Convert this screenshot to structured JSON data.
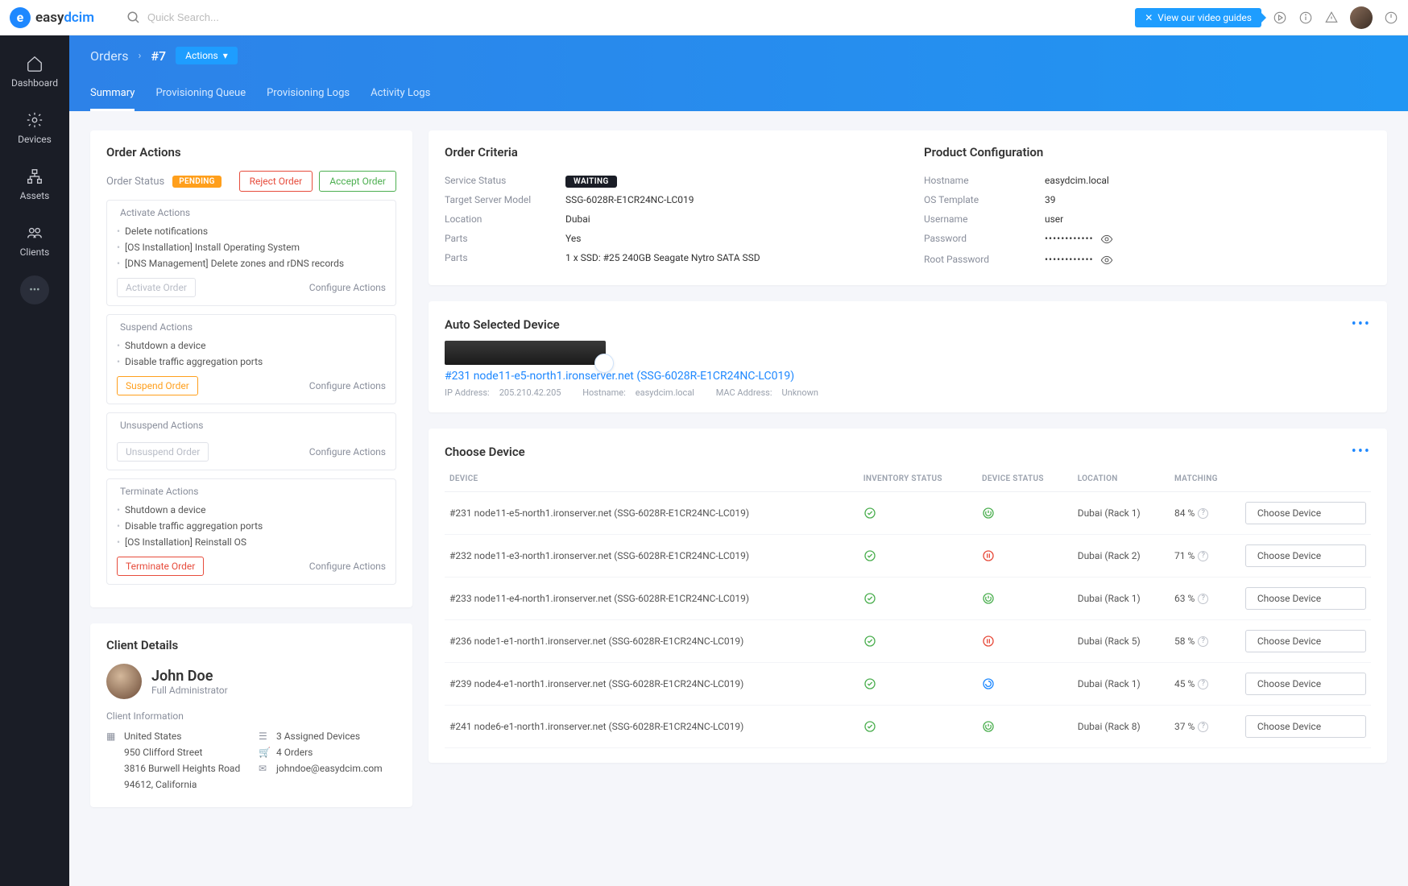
{
  "logo": {
    "text_dark": "easy",
    "text_accent": "dcim"
  },
  "search": {
    "placeholder": "Quick Search..."
  },
  "topbar": {
    "video_guides_label": "View our video guides"
  },
  "sidebar": {
    "items": [
      {
        "label": "Dashboard"
      },
      {
        "label": "Devices"
      },
      {
        "label": "Assets"
      },
      {
        "label": "Clients"
      }
    ]
  },
  "breadcrumb": {
    "orders": "Orders",
    "current": "#7",
    "actions_btn": "Actions"
  },
  "tabs": [
    {
      "label": "Summary",
      "active": true
    },
    {
      "label": "Provisioning Queue"
    },
    {
      "label": "Provisioning Logs"
    },
    {
      "label": "Activity Logs"
    }
  ],
  "order_actions": {
    "title": "Order Actions",
    "status_label": "Order Status",
    "status_badge": "PENDING",
    "reject_btn": "Reject Order",
    "accept_btn": "Accept Order",
    "groups": [
      {
        "title": "Activate Actions",
        "items": [
          "Delete notifications",
          "[OS Installation] Install Operating System",
          "[DNS Management] Delete zones and rDNS records"
        ],
        "primary_btn": "Activate Order",
        "primary_style": "disabled",
        "config_link": "Configure Actions"
      },
      {
        "title": "Suspend Actions",
        "items": [
          "Shutdown a device",
          "Disable traffic aggregation ports"
        ],
        "primary_btn": "Suspend Order",
        "primary_style": "warn",
        "config_link": "Configure Actions"
      },
      {
        "title": "Unsuspend Actions",
        "items": [],
        "primary_btn": "Unsuspend Order",
        "primary_style": "disabled",
        "config_link": "Configure Actions"
      },
      {
        "title": "Terminate Actions",
        "items": [
          "Shutdown a device",
          "Disable traffic aggregation ports",
          "[OS Installation] Reinstall OS"
        ],
        "primary_btn": "Terminate Order",
        "primary_style": "danger",
        "config_link": "Configure Actions"
      }
    ]
  },
  "client": {
    "title": "Client Details",
    "name": "John Doe",
    "role": "Full Administrator",
    "info_title": "Client Information",
    "address": [
      "United States",
      "950 Clifford Street",
      "3816 Burwell Heights Road",
      "94612, California"
    ],
    "stats": {
      "devices": "3 Assigned Devices",
      "orders": "4 Orders",
      "email": "johndoe@easydcim.com"
    }
  },
  "order_criteria": {
    "title": "Order Criteria",
    "rows": [
      {
        "label": "Service Status",
        "value": "WAITING",
        "badge": true
      },
      {
        "label": "Target Server Model",
        "value": "SSG-6028R-E1CR24NC-LC019"
      },
      {
        "label": "Location",
        "value": "Dubai"
      },
      {
        "label": "Parts",
        "value": "Yes"
      },
      {
        "label": "Parts",
        "value": "1 x SSD: #25 240GB Seagate Nytro SATA SSD"
      }
    ]
  },
  "product_config": {
    "title": "Product Configuration",
    "rows": [
      {
        "label": "Hostname",
        "value": "easydcim.local"
      },
      {
        "label": "OS Template",
        "value": "39"
      },
      {
        "label": "Username",
        "value": "user"
      },
      {
        "label": "Password",
        "value": "••••••••••••",
        "eye": true
      },
      {
        "label": "Root Password",
        "value": "••••••••••••",
        "eye": true
      }
    ]
  },
  "auto_device": {
    "title": "Auto Selected Device",
    "link": "#231 node11-e5-north1.ironserver.net (SSG-6028R-E1CR24NC-LC019)",
    "meta": {
      "ip_label": "IP Address:",
      "ip": "205.210.42.205",
      "host_label": "Hostname:",
      "host": "easydcim.local",
      "mac_label": "MAC Address:",
      "mac": "Unknown"
    }
  },
  "choose_device": {
    "title": "Choose Device",
    "headers": [
      "DEVICE",
      "INVENTORY STATUS",
      "DEVICE STATUS",
      "LOCATION",
      "MATCHING",
      ""
    ],
    "choose_btn": "Choose Device",
    "rows": [
      {
        "name": "#231 node11-e5-north1.ironserver.net (SSG-6028R-E1CR24NC-LC019)",
        "inv": "ok",
        "dev": "power",
        "loc": "Dubai (Rack 1)",
        "match": "84 %"
      },
      {
        "name": "#232 node11-e3-north1.ironserver.net (SSG-6028R-E1CR24NC-LC019)",
        "inv": "ok",
        "dev": "pause",
        "loc": "Dubai (Rack 2)",
        "match": "71 %"
      },
      {
        "name": "#233 node11-e4-north1.ironserver.net (SSG-6028R-E1CR24NC-LC019)",
        "inv": "ok",
        "dev": "power",
        "loc": "Dubai (Rack 1)",
        "match": "63 %"
      },
      {
        "name": "#236 node1-e1-north1.ironserver.net (SSG-6028R-E1CR24NC-LC019)",
        "inv": "ok",
        "dev": "pause",
        "loc": "Dubai (Rack 5)",
        "match": "58 %"
      },
      {
        "name": "#239 node4-e1-north1.ironserver.net (SSG-6028R-E1CR24NC-LC019)",
        "inv": "ok",
        "dev": "spin",
        "loc": "Dubai (Rack 1)",
        "match": "45 %"
      },
      {
        "name": "#241 node6-e1-north1.ironserver.net (SSG-6028R-E1CR24NC-LC019)",
        "inv": "ok",
        "dev": "power",
        "loc": "Dubai (Rack 8)",
        "match": "37 %"
      }
    ]
  }
}
